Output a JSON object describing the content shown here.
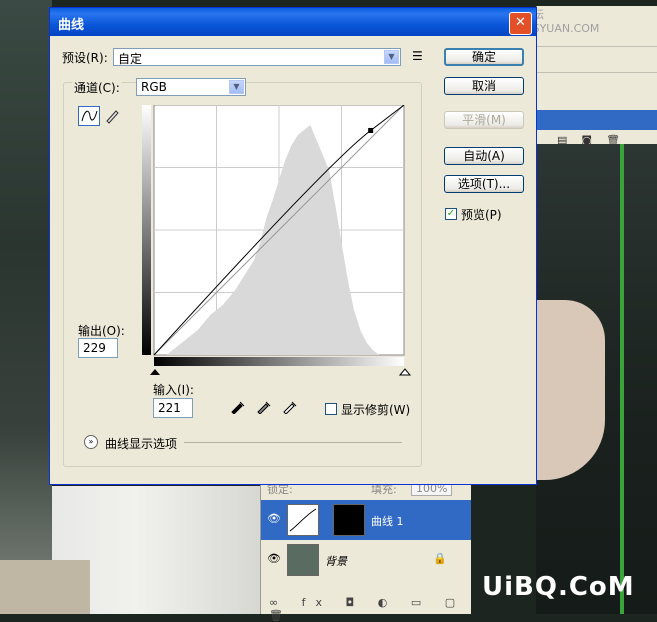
{
  "watermark_top": "思缘设计论坛 WWW.MISSYUAN.COM",
  "watermark_bottom": "UiBQ.CoM",
  "dialog": {
    "title": "曲线",
    "close_icon": "close-icon",
    "preset_label": "预设(R):",
    "preset_value": "自定",
    "channel_label": "通道(C):",
    "channel_value": "RGB",
    "output_label": "输出(O):",
    "output_value": "229",
    "input_label": "输入(I):",
    "input_value": "221",
    "show_clipping_label": "显示修剪(W)",
    "curve_display_options_label": "曲线显示选项",
    "buttons": {
      "ok": "确定",
      "cancel": "取消",
      "smooth": "平滑(M)",
      "auto": "自动(A)",
      "options": "选项(T)..."
    },
    "preview_label": "预览(P)",
    "preview_checked": true,
    "show_clipping_checked": false
  },
  "curve": {
    "control_point": {
      "input": 221,
      "output": 229
    },
    "end_points": [
      {
        "input": 0,
        "output": 0
      },
      {
        "input": 255,
        "output": 255
      }
    ]
  },
  "layers": {
    "lock_label": "锁定:",
    "fill_label": "填充:",
    "fill_value": "100%",
    "rows": [
      {
        "name": "曲线 1",
        "selected": true
      },
      {
        "name": "背景",
        "selected": false
      }
    ]
  },
  "colors": {
    "title_bar": "#0a56d8",
    "dialog_bg": "#ece9d8",
    "selection": "#316ac5"
  }
}
